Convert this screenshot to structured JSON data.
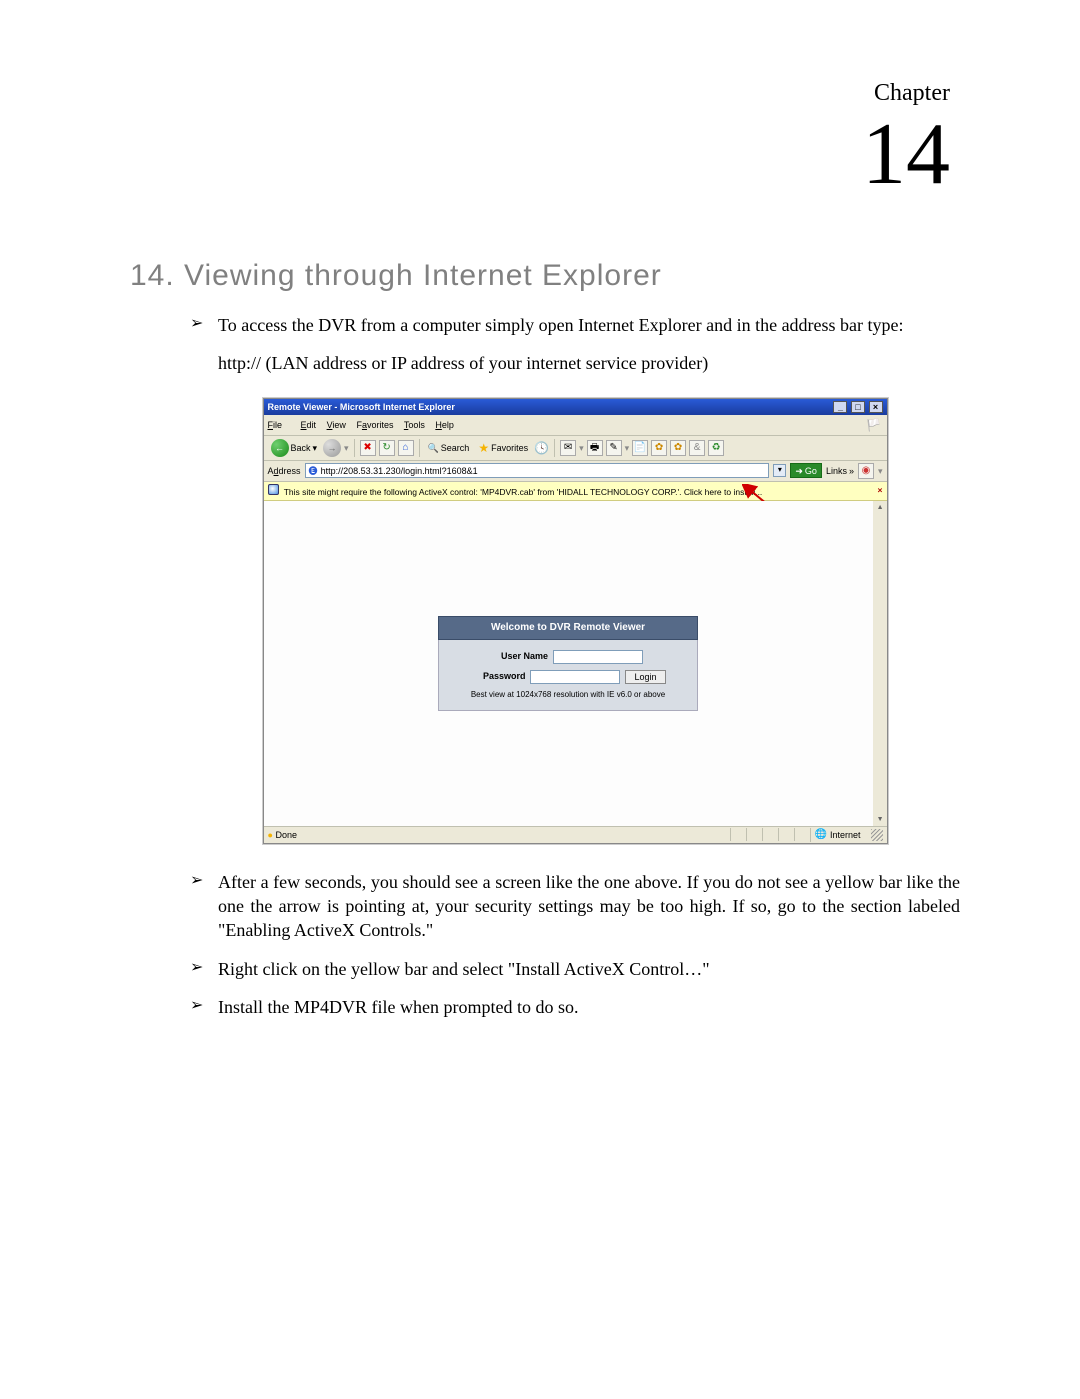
{
  "chapter": {
    "label": "Chapter",
    "number": "14"
  },
  "section_title": "14. Viewing through Internet Explorer",
  "bullets_top": {
    "b1": "To access the DVR from a computer simply open Internet Explorer and in the address bar type:"
  },
  "url_line": "http:// (LAN address or IP address of your internet service provider)",
  "bullets_bottom": {
    "b1": "After a few seconds, you should see a screen like the one above. If you do not see a yellow bar like the one the arrow is pointing at, your security settings may be too high. If so, go to the section labeled \"Enabling ActiveX Controls.\"",
    "b2": "Right click on the yellow bar and select \"Install ActiveX Control…\"",
    "b3": "Install the MP4DVR file when prompted to do so."
  },
  "ie": {
    "title": "Remote Viewer - Microsoft Internet Explorer",
    "menus": {
      "file": "File",
      "edit": "Edit",
      "view": "View",
      "favorites": "Favorites",
      "tools": "Tools",
      "help": "Help"
    },
    "toolbar": {
      "back": "Back",
      "search": "Search",
      "favorites": "Favorites"
    },
    "address_label": "Address",
    "address_value": "http://208.53.31.230/login.html?1608&1",
    "go_label": "Go",
    "links_label": "Links",
    "infobar_text": "This site might require the following ActiveX control: 'MP4DVR.cab' from 'HIDALL TECHNOLOGY CORP.'. Click here to install...",
    "login": {
      "heading": "Welcome to DVR Remote Viewer",
      "user_label": "User Name",
      "pass_label": "Password",
      "login_btn": "Login",
      "note": "Best view at 1024x768 resolution with IE v6.0 or above"
    },
    "status": {
      "done": "Done",
      "zone": "Internet"
    }
  },
  "bullet_glyph": "➢"
}
